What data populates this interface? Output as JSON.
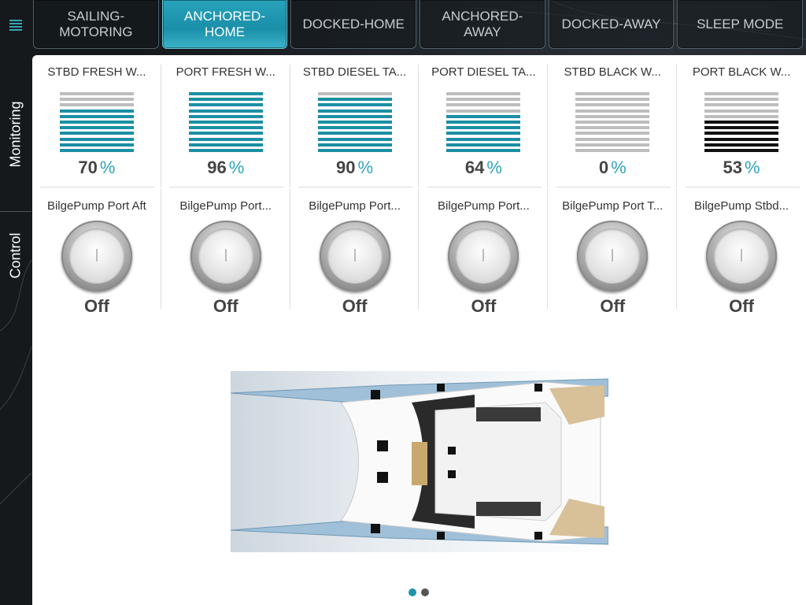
{
  "modes": [
    {
      "label": "SAILING-\nMOTORING",
      "active": false
    },
    {
      "label": "ANCHORED-\nHOME",
      "active": true
    },
    {
      "label": "DOCKED-HOME",
      "active": false
    },
    {
      "label": "ANCHORED-\nAWAY",
      "active": false
    },
    {
      "label": "DOCKED-AWAY",
      "active": false
    },
    {
      "label": "SLEEP MODE",
      "active": false
    }
  ],
  "side_tabs": {
    "monitoring": "Monitoring",
    "control": "Control"
  },
  "tanks": [
    {
      "name": "STBD FRESH W...",
      "value": "70",
      "unit": "%",
      "level": 0.7,
      "color": "#1b8fa3"
    },
    {
      "name": "PORT FRESH W...",
      "value": "96",
      "unit": "%",
      "level": 0.96,
      "color": "#1b8fa3"
    },
    {
      "name": "STBD DIESEL TA...",
      "value": "90",
      "unit": "%",
      "level": 0.9,
      "color": "#1b8fa3"
    },
    {
      "name": "PORT DIESEL TA...",
      "value": "64",
      "unit": "%",
      "level": 0.64,
      "color": "#1b8fa3"
    },
    {
      "name": "STBD BLACK W...",
      "value": "0",
      "unit": "%",
      "level": 0.0,
      "color": "#111111"
    },
    {
      "name": "PORT BLACK W...",
      "value": "53",
      "unit": "%",
      "level": 0.53,
      "color": "#111111"
    }
  ],
  "pumps": [
    {
      "name": "BilgePump Port Aft",
      "state": "Off"
    },
    {
      "name": "BilgePump Port...",
      "state": "Off"
    },
    {
      "name": "BilgePump Port...",
      "state": "Off"
    },
    {
      "name": "BilgePump Port...",
      "state": "Off"
    },
    {
      "name": "BilgePump Port T...",
      "state": "Off"
    },
    {
      "name": "BilgePump Stbd...",
      "state": "Off"
    }
  ],
  "pages": {
    "count": 2,
    "active": 0
  },
  "colors": {
    "accent": "#1f95aa",
    "tank_fill": "#1b8fa3",
    "empty_segment": "#bdbdbd"
  },
  "icons": {
    "menu": "hamburger-menu-icon"
  }
}
